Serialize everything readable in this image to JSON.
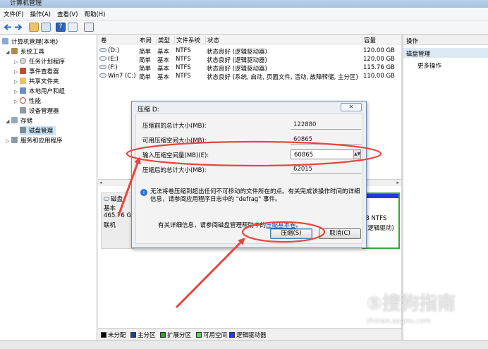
{
  "window": {
    "title": "计算机管理"
  },
  "menu": [
    "文件(F)",
    "操作(A)",
    "查看(V)",
    "帮助(H)"
  ],
  "tree": {
    "root": "计算机管理(本地)",
    "system_tools": "系统工具",
    "task_scheduler": "任务计划程序",
    "event_viewer": "事件查看器",
    "shared_folders": "共享文件夹",
    "local_users": "本地用户和组",
    "performance": "性能",
    "device_manager": "设备管理器",
    "storage": "存储",
    "disk_management": "磁盘管理",
    "services": "服务和应用程序"
  },
  "volume_table": {
    "headers": {
      "volume": "卷",
      "layout": "布局",
      "type": "类型",
      "fs": "文件系统",
      "status": "状态",
      "capacity": "容量"
    },
    "rows": [
      {
        "volume": "(D:)",
        "layout": "简单",
        "type": "基本",
        "fs": "NTFS",
        "status": "状态良好 (逻辑驱动器)",
        "capacity": "120.00 GB"
      },
      {
        "volume": "(E:)",
        "layout": "简单",
        "type": "基本",
        "fs": "NTFS",
        "status": "状态良好 (逻辑驱动器)",
        "capacity": "120.00 GB"
      },
      {
        "volume": "(F:)",
        "layout": "简单",
        "type": "基本",
        "fs": "NTFS",
        "status": "状态良好 (逻辑驱动器)",
        "capacity": "115.76 GB"
      },
      {
        "volume": "Win7 (C:)",
        "layout": "简单",
        "type": "基本",
        "fs": "NTFS",
        "status": "状态良好 (系统, 启动, 页面文件, 活动, 故障转储, 主分区)",
        "capacity": "110.00 GB"
      }
    ]
  },
  "disk_graph": {
    "disk_label": "磁盘",
    "disk_type": "基本",
    "disk_size": "465.76 GB",
    "disk_status": "联机",
    "right_part_line1": "B NTFS",
    "right_part_line2": "(逻辑驱动)"
  },
  "legend": [
    {
      "label": "未分配",
      "color": "#000000"
    },
    {
      "label": "主分区",
      "color": "#1c3fa6"
    },
    {
      "label": "扩展分区",
      "color": "#2aa02a"
    },
    {
      "label": "可用空间",
      "color": "#55d855"
    },
    {
      "label": "逻辑驱动器",
      "color": "#1f3fd9"
    }
  ],
  "actions": {
    "header": "操作",
    "section": "磁盘管理",
    "more": "更多操作"
  },
  "dialog": {
    "title": "压缩 D:",
    "close_glyph": "✕",
    "fields": [
      {
        "label": "压缩前的总计大小(MB):",
        "value": "122880"
      },
      {
        "label": "可用压缩空间大小(MB):",
        "value": "60865"
      },
      {
        "label": "输入压缩空间量(MB)(E):",
        "value": "60865"
      },
      {
        "label": "压缩后的总计大小(MB):",
        "value": "62015"
      }
    ],
    "note": "无法将卷压缩到超出任何不可移动的文件所在的点。有关完成该操作时间的详细信息，请参阅应用程序日志中的 \"defrag\" 事件。",
    "info_prefix": "有关详细信息，请参阅磁盘管理帮助中的",
    "info_link": "压缩基本卷",
    "info_suffix": "。",
    "shrink_label": "压缩(S)",
    "cancel_label": "取消(C)"
  },
  "watermark": {
    "logo": "⑤搜狗指南",
    "url": "zhinan.sogou.com"
  },
  "colors": {
    "annotation": "#e8453c",
    "selection": "#cce4f7",
    "link": "#0645ad"
  }
}
